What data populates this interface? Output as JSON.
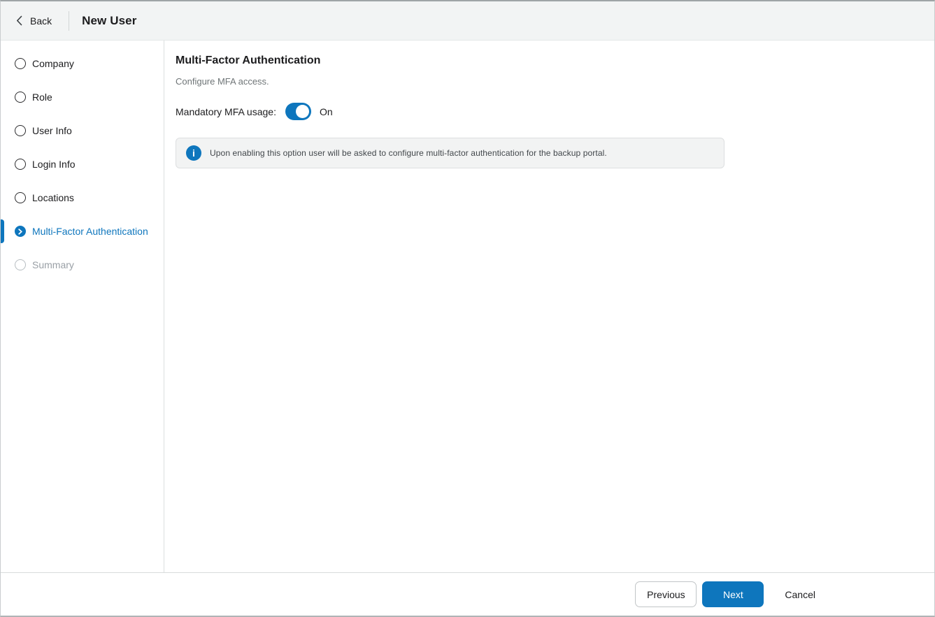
{
  "colors": {
    "accent_blue": "#0e76bd",
    "header_bg": "#f2f4f4",
    "banner_bg": "#f2f3f3",
    "muted_text": "#6f7577",
    "disabled_text": "#9aa0a6"
  },
  "header": {
    "back_label": "Back",
    "title": "New User"
  },
  "sidebar": {
    "steps": [
      {
        "label": "Company",
        "state": "pending"
      },
      {
        "label": "Role",
        "state": "pending"
      },
      {
        "label": "User Info",
        "state": "pending"
      },
      {
        "label": "Login Info",
        "state": "pending"
      },
      {
        "label": "Locations",
        "state": "pending"
      },
      {
        "label": "Multi-Factor Authentication",
        "state": "active"
      },
      {
        "label": "Summary",
        "state": "disabled"
      }
    ]
  },
  "content": {
    "title": "Multi-Factor Authentication",
    "subtitle": "Configure MFA access.",
    "mfa_toggle": {
      "label": "Mandatory MFA usage:",
      "state_label": "On",
      "enabled": true
    },
    "info_banner": {
      "icon": "info-icon",
      "text": "Upon enabling this option user will be asked to configure multi-factor authentication for the backup portal."
    }
  },
  "footer": {
    "previous_label": "Previous",
    "next_label": "Next",
    "cancel_label": "Cancel"
  }
}
